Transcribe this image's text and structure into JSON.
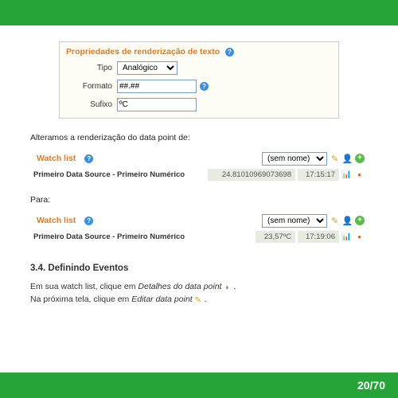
{
  "props": {
    "title": "Propriedades de renderização de texto",
    "labels": {
      "tipo": "Tipo",
      "formato": "Formato",
      "sufixo": "Sufixo"
    },
    "tipo_value": "Analógico",
    "formato_value": "##.##",
    "sufixo_value": "ºC"
  },
  "text": {
    "alteramos": "Alteramos a renderização do data point de:",
    "para": "Para:",
    "section_num": "3.4.",
    "section_title": "Definindo Eventos",
    "body1a": "Em sua watch list, clique em ",
    "body1b": "Detalhes do data point",
    "body2a": "Na próxima tela, clique em ",
    "body2b": "Editar data point"
  },
  "watch": {
    "title": "Watch list",
    "select": "(sem nome)",
    "item_label": "Primeiro Data Source - Primeiro Numérico"
  },
  "before": {
    "value": "24.81010969073698",
    "time": "17:15:17"
  },
  "after": {
    "value": "23,57ºC",
    "time": "17:19:06"
  },
  "footer": {
    "page": "20/70"
  }
}
